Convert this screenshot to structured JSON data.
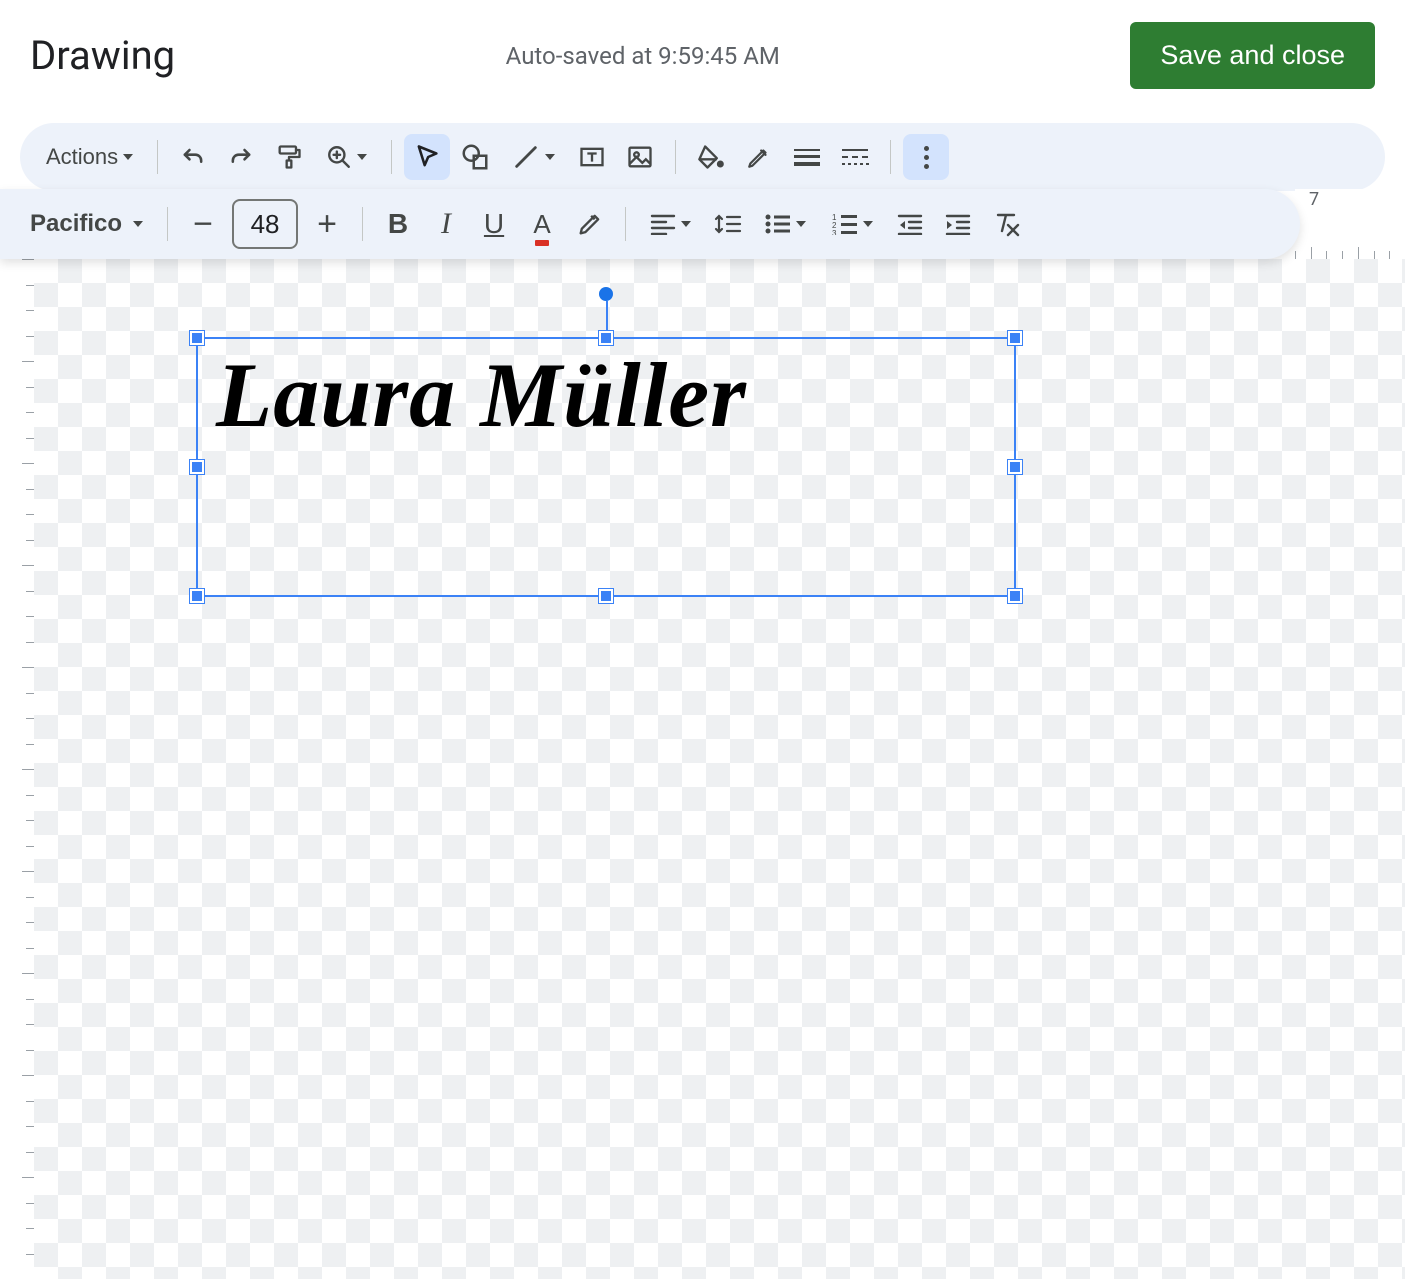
{
  "header": {
    "title": "Drawing",
    "status": "Auto-saved at 9:59:45 AM",
    "save_label": "Save and close"
  },
  "toolbar1": {
    "actions_label": "Actions"
  },
  "toolbar2": {
    "font_name": "Pacifico",
    "font_size": "48"
  },
  "ruler": {
    "label": "7"
  },
  "textbox": {
    "content": "Laura Müller"
  }
}
